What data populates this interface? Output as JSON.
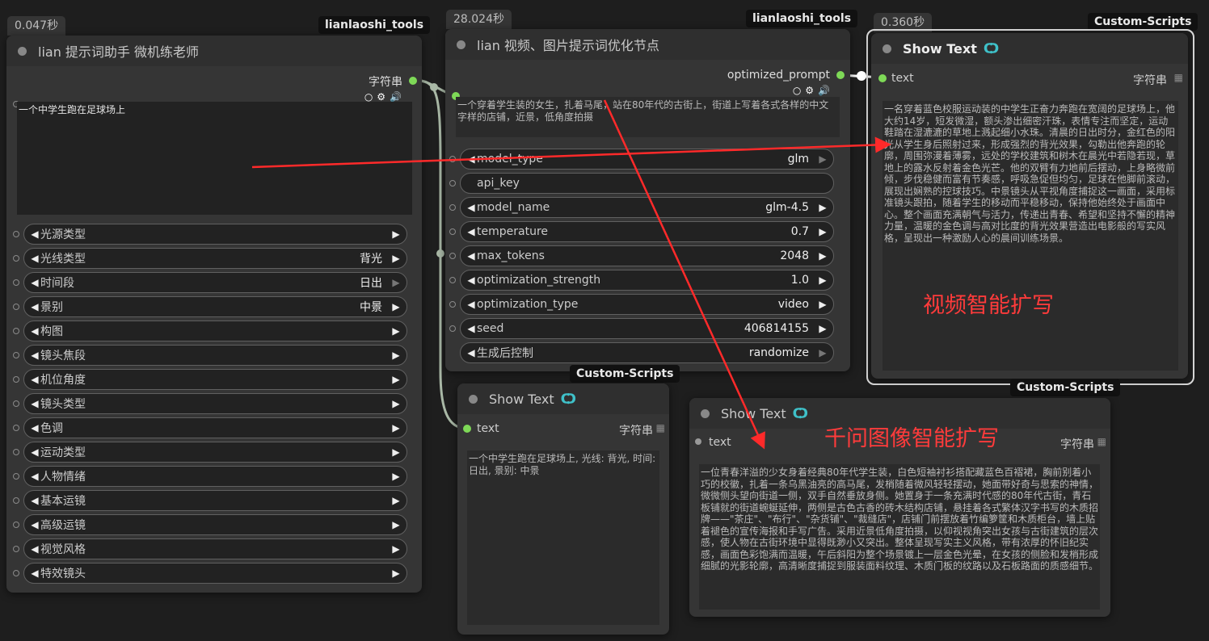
{
  "node_left": {
    "time": "0.047秒",
    "tag": "lianlaoshi_tools",
    "title": "lian 提示词助手 微机练老师",
    "output_label": "字符串",
    "input_text": "一个中学生跑在足球场上",
    "widgets": [
      {
        "label": "光源类型",
        "value": ""
      },
      {
        "label": "光线类型",
        "value": "背光"
      },
      {
        "label": "时间段",
        "value": "日出"
      },
      {
        "label": "景别",
        "value": "中景"
      },
      {
        "label": "构图",
        "value": ""
      },
      {
        "label": "镜头焦段",
        "value": ""
      },
      {
        "label": "机位角度",
        "value": ""
      },
      {
        "label": "镜头类型",
        "value": ""
      },
      {
        "label": "色调",
        "value": ""
      },
      {
        "label": "运动类型",
        "value": ""
      },
      {
        "label": "人物情绪",
        "value": ""
      },
      {
        "label": "基本运镜",
        "value": ""
      },
      {
        "label": "高级运镜",
        "value": ""
      },
      {
        "label": "视觉风格",
        "value": ""
      },
      {
        "label": "特效镜头",
        "value": ""
      }
    ]
  },
  "node_mid": {
    "time": "28.024秒",
    "tag": "lianlaoshi_tools",
    "title": "lian 视频、图片提示词优化节点",
    "output_label": "optimized_prompt",
    "input_text": "一个穿着学生装的女生，扎着马尾，站在80年代的古街上，街道上写着各式各样的中文字样的店铺，近景，低角度拍摄",
    "widgets": [
      {
        "label": "model_type",
        "value": "glm"
      },
      {
        "label": "api_key",
        "value": ""
      },
      {
        "label": "model_name",
        "value": "glm-4.5"
      },
      {
        "label": "temperature",
        "value": "0.7"
      },
      {
        "label": "max_tokens",
        "value": "2048"
      },
      {
        "label": "optimization_strength",
        "value": "1.0"
      },
      {
        "label": "optimization_type",
        "value": "video"
      },
      {
        "label": "seed",
        "value": "406814155"
      },
      {
        "label": "生成后控制",
        "value": "randomize"
      }
    ]
  },
  "node_show1": {
    "time": "0.360秒",
    "tag_top": "Custom-Scripts",
    "tag_bottom": "Custom-Scripts",
    "title": "Show Text",
    "input_label": "text",
    "output_label": "字符串",
    "text": "一名穿着蓝色校服运动装的中学生正奋力奔跑在宽阔的足球场上，他大约14岁，短发微湿，额头渗出细密汗珠，表情专注而坚定，运动鞋踏在湿漉漉的草地上溅起细小水珠。清晨的日出时分，金红色的阳光从学生身后照射过来，形成强烈的背光效果，勾勒出他奔跑的轮廓，周围弥漫着薄雾，远处的学校建筑和树木在晨光中若隐若现，草地上的露水反射着金色光芒。他的双臂有力地前后摆动，上身略微前倾，步伐稳健而富有节奏感，呼吸急促但均匀，足球在他脚前滚动，展现出娴熟的控球技巧。中景镜头从平视角度捕捉这一画面，采用标准镜头跟拍，随着学生的移动而平稳移动，保持他始终处于画面中心。整个画面充满朝气与活力，传递出青春、希望和坚持不懈的精神力量，温暖的金色调与高对比度的背光效果营造出电影般的写实风格，呈现出一种激励人心的晨间训练场景。"
  },
  "node_show2": {
    "tag": "Custom-Scripts",
    "title": "Show Text",
    "input_label": "text",
    "output_label": "字符串",
    "text": "一个中学生跑在足球场上, 光线: 背光, 时间: 日出, 景别: 中景"
  },
  "node_show3": {
    "title": "Show Text",
    "input_label": "text",
    "output_label": "字符串",
    "text": "一位青春洋溢的少女身着经典80年代学生装，白色短袖衬衫搭配藏蓝色百褶裙，胸前别着小巧的校徽，扎着一条乌黑油亮的高马尾，发梢随着微风轻轻摆动，她面带好奇与思索的神情，微微侧头望向街道一侧，双手自然垂放身侧。她置身于一条充满时代感的80年代古街，青石板铺就的街道蜿蜒延伸，两侧是古色古香的砖木结构店铺，悬挂着各式繁体汉字书写的木质招牌——\"茶庄\"、\"布行\"、\"杂货铺\"、\"裁缝店\"，店铺门前摆放着竹编箩筐和木质柜台，墙上贴着褪色的宣传海报和手写广告。采用近景低角度拍摄，以仰视视角突出女孩与古街建筑的层次感，使人物在古街环境中显得既渺小又突出。整体呈现写实主义风格，带有浓厚的怀旧纪实感，画面色彩饱满而温暖，午后斜阳为整个场景镀上一层金色光晕，在女孩的侧脸和发梢形成细腻的光影轮廓，高清晰度捕捉到服装面料纹理、木质门板的纹路以及石板路面的质感细节。"
  },
  "annotations": {
    "video": "视频智能扩写",
    "image": "千问图像智能扩写"
  },
  "colors": {
    "socket_active": "#7ed957",
    "annotation": "#ff3b3b",
    "node_bg": "#353535",
    "canvas": "#1e1e1e"
  }
}
